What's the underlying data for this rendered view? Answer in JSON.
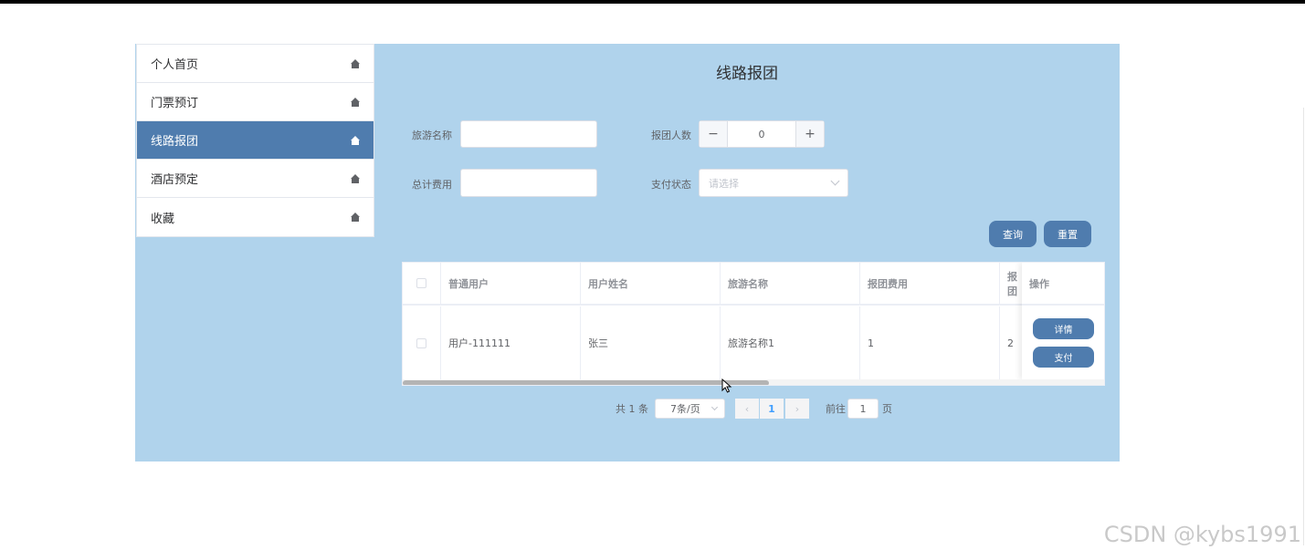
{
  "sidebar": {
    "items": [
      {
        "label": "个人首页",
        "icon": "home-icon",
        "active": false
      },
      {
        "label": "门票预订",
        "icon": "home-icon",
        "active": false
      },
      {
        "label": "线路报团",
        "icon": "home-icon",
        "active": true
      },
      {
        "label": "酒店预定",
        "icon": "home-icon",
        "active": false
      },
      {
        "label": "收藏",
        "icon": "home-icon",
        "active": false
      }
    ]
  },
  "page": {
    "title": "线路报团"
  },
  "search": {
    "tour_name_label": "旅游名称",
    "tour_name_value": "",
    "group_count_label": "报团人数",
    "group_count_value": "0",
    "total_fee_label": "总计费用",
    "total_fee_value": "",
    "pay_status_label": "支付状态",
    "pay_status_placeholder": "请选择",
    "query_button": "查询",
    "reset_button": "重置"
  },
  "table": {
    "columns": [
      "普通用户",
      "用户姓名",
      "旅游名称",
      "报团费用",
      "报团",
      "操作"
    ],
    "rows": [
      {
        "user": "用户-111111",
        "name": "张三",
        "tour": "旅游名称1",
        "fee": "1",
        "count": "2",
        "detail_label": "详情",
        "pay_label": "支付"
      }
    ]
  },
  "pagination": {
    "total_text": "共 1 条",
    "page_size": "7条/页",
    "current_page": "1",
    "goto_label": "前往",
    "goto_value": "1",
    "page_suffix": "页"
  },
  "watermark": "CSDN @kybs1991",
  "colors": {
    "panel_bg": "#b0d3ec",
    "accent": "#4f7cae"
  }
}
